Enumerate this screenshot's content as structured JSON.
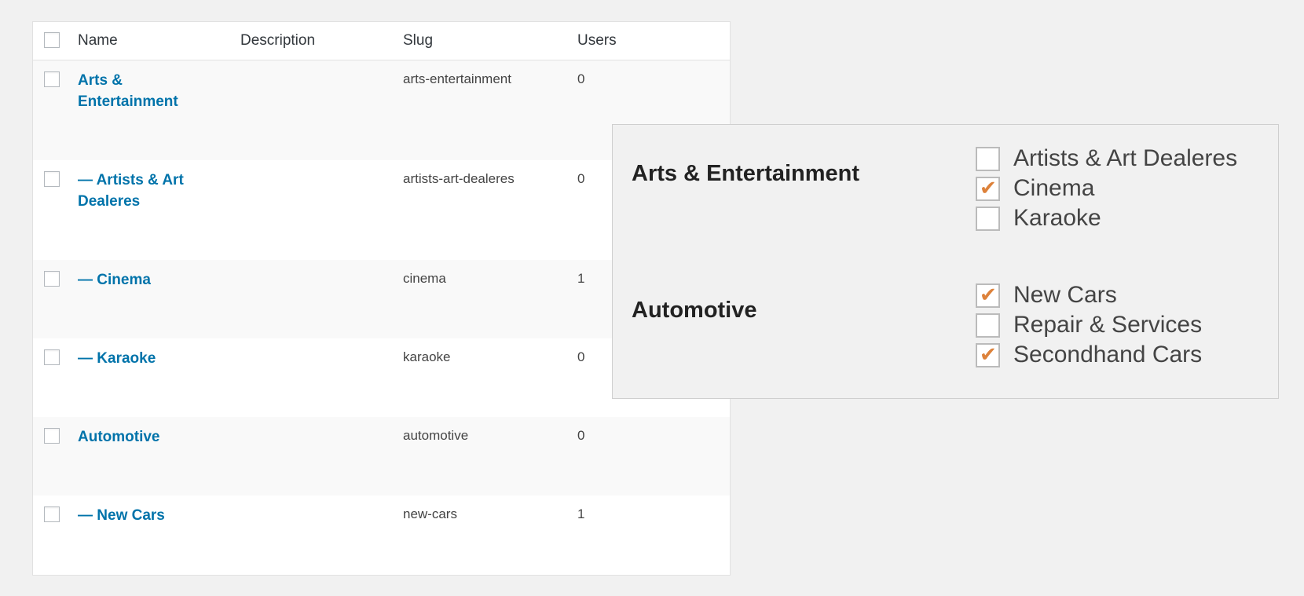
{
  "table": {
    "headers": {
      "name": "Name",
      "description": "Description",
      "slug": "Slug",
      "users": "Users"
    },
    "rows": [
      {
        "name": "Arts & Entertainment",
        "description": "",
        "slug": "arts-entertainment",
        "users": "0"
      },
      {
        "name": "— Artists & Art Dealeres",
        "description": "",
        "slug": "artists-art-dealeres",
        "users": "0"
      },
      {
        "name": "— Cinema",
        "description": "",
        "slug": "cinema",
        "users": "1"
      },
      {
        "name": "— Karaoke",
        "description": "",
        "slug": "karaoke",
        "users": "0"
      },
      {
        "name": "Automotive",
        "description": "",
        "slug": "automotive",
        "users": "0"
      },
      {
        "name": "— New Cars",
        "description": "",
        "slug": "new-cars",
        "users": "1"
      }
    ]
  },
  "overlay": {
    "groups": [
      {
        "title": "Arts & Entertainment",
        "options": [
          {
            "label": "Artists & Art Dealeres",
            "checked": false
          },
          {
            "label": "Cinema",
            "checked": true
          },
          {
            "label": "Karaoke",
            "checked": false
          }
        ]
      },
      {
        "title": "Automotive",
        "options": [
          {
            "label": "New Cars",
            "checked": true
          },
          {
            "label": "Repair & Services",
            "checked": false
          },
          {
            "label": "Secondhand Cars",
            "checked": true
          }
        ]
      }
    ],
    "check_glyph": "✔",
    "check_color": "#dd823b"
  },
  "colors": {
    "link": "#0073aa",
    "background": "#f1f1f1"
  }
}
